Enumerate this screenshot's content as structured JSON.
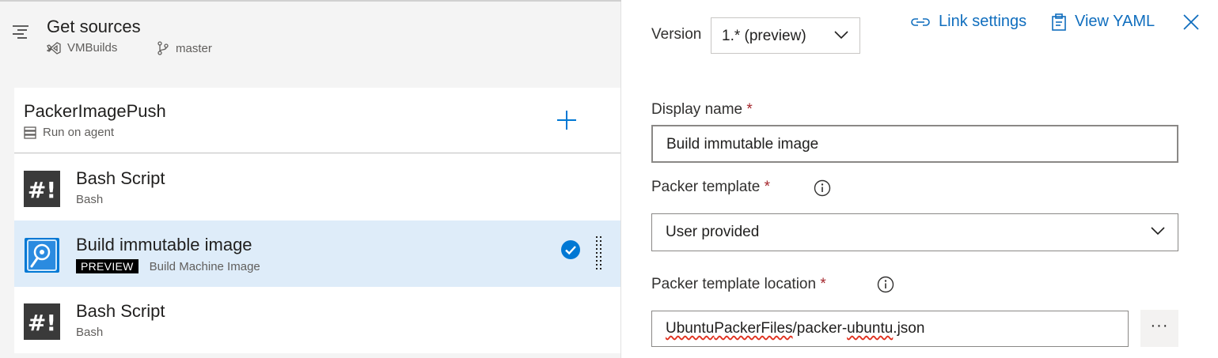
{
  "get_sources": {
    "title": "Get sources",
    "repo": "VMBuilds",
    "branch": "master"
  },
  "job": {
    "title": "PackerImagePush",
    "subtitle": "Run on agent"
  },
  "tasks": [
    {
      "name": "Bash Script",
      "type": "Bash",
      "icon": "bash-script-icon"
    },
    {
      "name": "Build immutable image",
      "badge": "PREVIEW",
      "type": "Build Machine Image",
      "icon": "build-machine-image-icon",
      "selected": true
    },
    {
      "name": "Bash Script",
      "type": "Bash",
      "icon": "bash-script-icon"
    }
  ],
  "panel": {
    "version_label": "Version",
    "version_value": "1.* (preview)",
    "link_settings": "Link settings",
    "view_yaml": "View YAML",
    "display_name_label": "Display name",
    "display_name_value": "Build immutable image",
    "packer_template_label": "Packer template",
    "packer_template_value": "User provided",
    "template_location_label": "Packer template location",
    "template_location_parts": [
      "Ubuntu",
      "PackerFiles",
      "/packer-",
      "ubuntu",
      ".json"
    ],
    "required_mark": "*",
    "more_label": "···"
  },
  "colors": {
    "accent": "#0078d4",
    "selected_row": "#deecf9",
    "required": "#a4262c",
    "link": "#106ebe"
  }
}
